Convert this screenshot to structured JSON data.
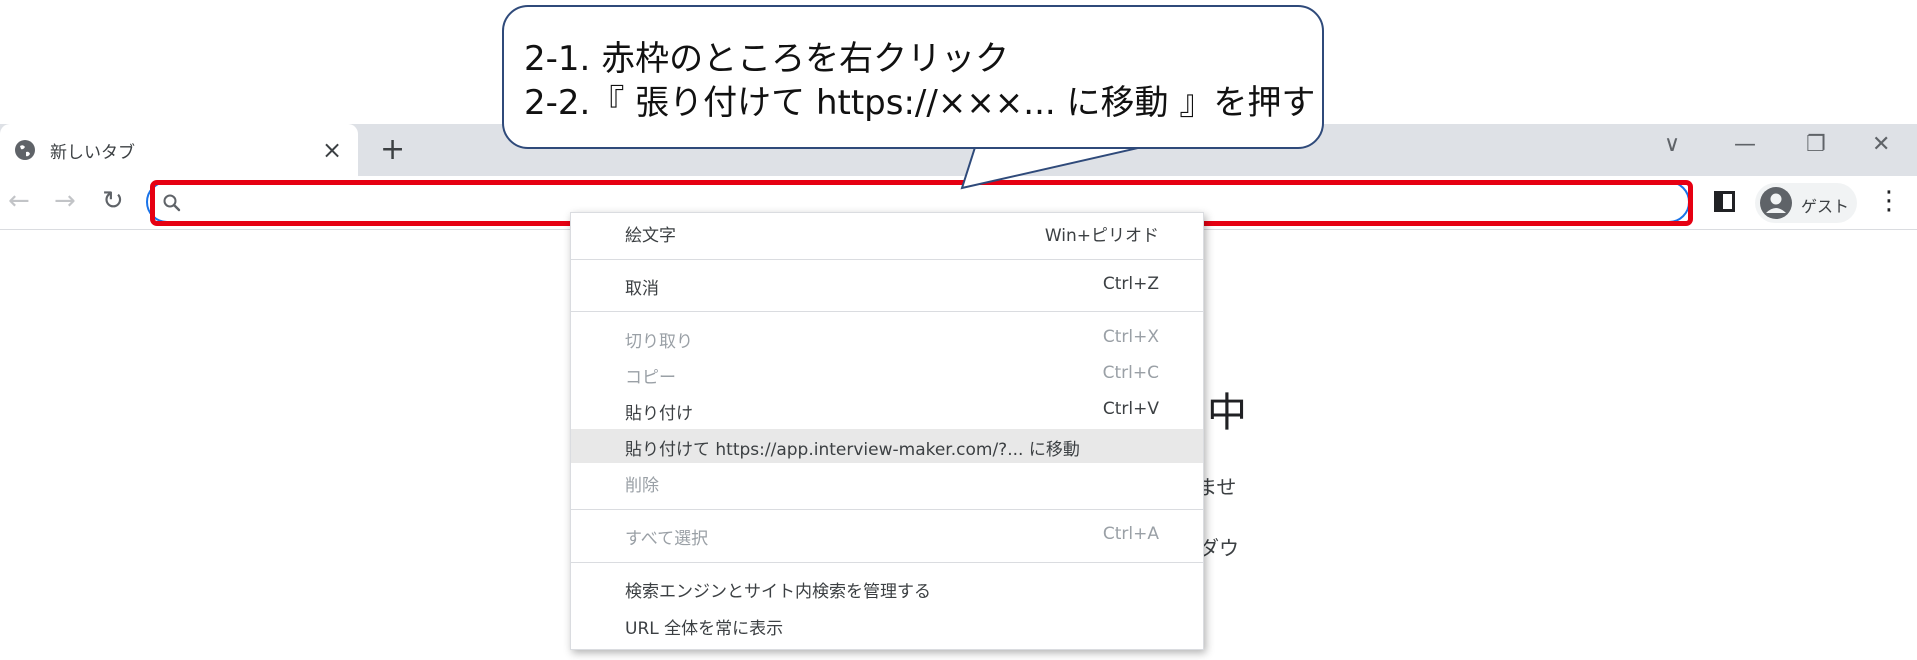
{
  "tab": {
    "title": "新しいタブ",
    "close": "×"
  },
  "newtab": "+",
  "window_controls": {
    "dropdown": "∨",
    "minimize": "—",
    "restore": "❐",
    "close": "✕"
  },
  "nav": {
    "back": "←",
    "forward": "→",
    "reload": "↻"
  },
  "omnibox": {
    "value": "",
    "placeholder": ""
  },
  "profile": {
    "name": "ゲスト"
  },
  "menu_dots": "⋮",
  "background_page": {
    "heading": "中",
    "line1": "ませ",
    "line2": "ダウ"
  },
  "context_menu": {
    "items": [
      {
        "label": "絵文字",
        "shortcut": "Win+ピリオド",
        "enabled": true
      },
      {
        "label": "取消",
        "shortcut": "Ctrl+Z",
        "enabled": true
      },
      {
        "label": "切り取り",
        "shortcut": "Ctrl+X",
        "enabled": false
      },
      {
        "label": "コピー",
        "shortcut": "Ctrl+C",
        "enabled": false
      },
      {
        "label": "貼り付け",
        "shortcut": "Ctrl+V",
        "enabled": true
      },
      {
        "label": "貼り付けて https://app.interview-maker.com/?... に移動",
        "shortcut": "",
        "enabled": true,
        "highlighted": true
      },
      {
        "label": "削除",
        "shortcut": "",
        "enabled": false
      },
      {
        "label": "すべて選択",
        "shortcut": "Ctrl+A",
        "enabled": false
      },
      {
        "label": "検索エンジンとサイト内検索を管理する",
        "shortcut": "",
        "enabled": true
      },
      {
        "label": "URL 全体を常に表示",
        "shortcut": "",
        "enabled": true
      }
    ]
  },
  "callout": {
    "line1": "2-1. 赤枠のところを右クリック",
    "line2": "2-2.『 張り付けて https://×××... に移動 』を押す",
    "border_color": "#2f4a7a"
  },
  "highlight_color": "#e60012"
}
